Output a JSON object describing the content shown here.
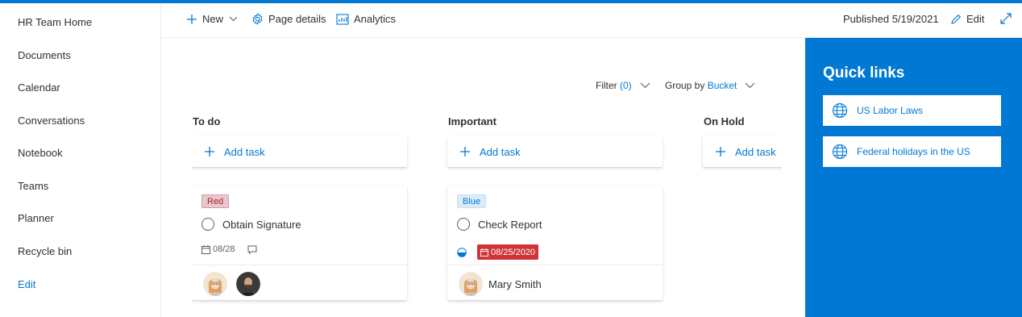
{
  "leftnav": {
    "items": [
      {
        "label": "HR Team Home"
      },
      {
        "label": "Documents"
      },
      {
        "label": "Calendar"
      },
      {
        "label": "Conversations"
      },
      {
        "label": "Notebook"
      },
      {
        "label": "Teams"
      },
      {
        "label": "Planner"
      },
      {
        "label": "Recycle bin"
      }
    ],
    "edit_label": "Edit"
  },
  "commandbar": {
    "new_label": "New",
    "page_details_label": "Page details",
    "analytics_label": "Analytics",
    "published_label": "Published 5/19/2021",
    "edit_label": "Edit"
  },
  "board": {
    "filter_label": "Filter",
    "filter_count": "(0)",
    "group_by_label": "Group by",
    "group_by_value": "Bucket",
    "buckets": [
      {
        "title": "To do",
        "add_label": "Add task"
      },
      {
        "title": "Important",
        "add_label": "Add task"
      },
      {
        "title": "On Hold",
        "add_label": "Add task"
      }
    ],
    "tasks": [
      {
        "label": "Red",
        "title": "Obtain Signature",
        "date": "08/28"
      },
      {
        "label": "Blue",
        "title": "Check Report",
        "due_date": "08/25/2020",
        "assignee": "Mary Smith"
      }
    ]
  },
  "quicklinks": {
    "title": "Quick links",
    "links": [
      {
        "label": "US Labor Laws",
        "icon": "globe-icon"
      },
      {
        "label": "Federal holidays in the US",
        "icon": "globe-icon"
      }
    ]
  },
  "colors": {
    "accent": "#0078d4",
    "overdue": "#d13438"
  }
}
